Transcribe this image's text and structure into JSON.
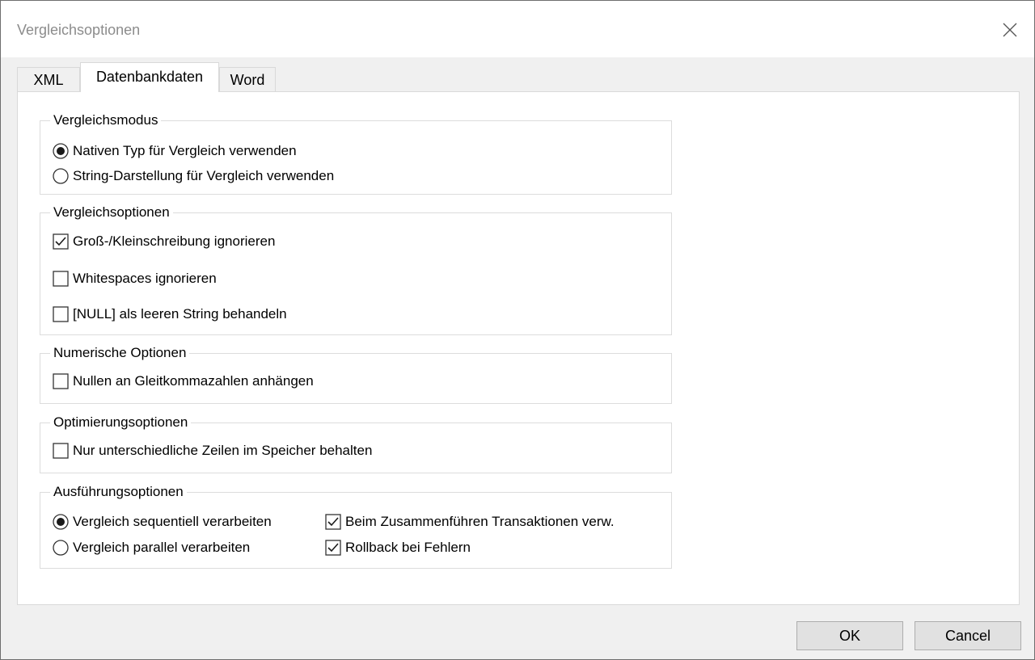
{
  "window": {
    "title": "Vergleichsoptionen"
  },
  "tabs": [
    {
      "label": "XML",
      "active": false
    },
    {
      "label": "Datenbankdaten",
      "active": true
    },
    {
      "label": "Word",
      "active": false
    }
  ],
  "groups": {
    "vergleichsmodus": {
      "legend": "Vergleichsmodus",
      "options": [
        {
          "label": "Nativen Typ für Vergleich verwenden",
          "selected": true
        },
        {
          "label": "String-Darstellung für Vergleich verwenden",
          "selected": false
        }
      ]
    },
    "vergleichsoptionen": {
      "legend": "Vergleichsoptionen",
      "options": [
        {
          "label": "Groß-/Kleinschreibung ignorieren",
          "checked": true
        },
        {
          "label": "Whitespaces ignorieren",
          "checked": false
        },
        {
          "label": "[NULL] als leeren String behandeln",
          "checked": false
        }
      ]
    },
    "numerisch": {
      "legend": "Numerische Optionen",
      "options": [
        {
          "label": "Nullen an Gleitkommazahlen anhängen",
          "checked": false
        }
      ]
    },
    "optimierung": {
      "legend": "Optimierungsoptionen",
      "options": [
        {
          "label": "Nur unterschiedliche Zeilen im Speicher behalten",
          "checked": false
        }
      ]
    },
    "ausfuehrung": {
      "legend": "Ausführungsoptionen",
      "radios": [
        {
          "label": "Vergleich sequentiell verarbeiten",
          "selected": true
        },
        {
          "label": "Vergleich parallel verarbeiten",
          "selected": false
        }
      ],
      "checks": [
        {
          "label": "Beim Zusammenführen Transaktionen verw.",
          "checked": true
        },
        {
          "label": "Rollback bei Fehlern",
          "checked": true
        }
      ]
    }
  },
  "buttons": {
    "ok": "OK",
    "cancel": "Cancel"
  },
  "icons": {
    "close": "close-icon",
    "radio": "radio-icon",
    "checkbox": "checkbox-icon"
  }
}
